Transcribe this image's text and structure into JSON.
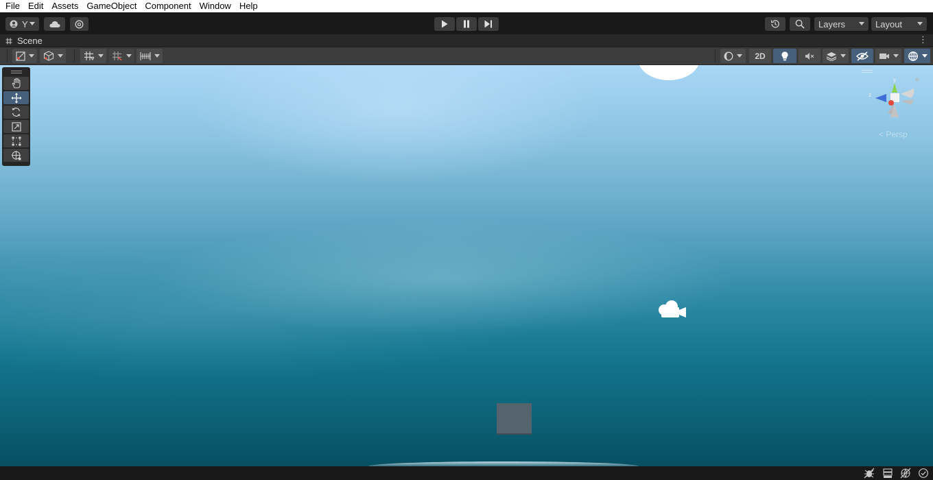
{
  "menu": [
    "File",
    "Edit",
    "Assets",
    "GameObject",
    "Component",
    "Window",
    "Help"
  ],
  "toolbar": {
    "account_label": "Y",
    "account_icon": "account-icon",
    "cloud_icon": "cloud-icon",
    "collab_icon": "services-icon",
    "play_icon": "play-icon",
    "pause_icon": "pause-icon",
    "step_icon": "step-icon",
    "history_icon": "history-icon",
    "search_icon": "search-icon",
    "layers_label": "Layers",
    "layout_label": "Layout"
  },
  "scene_tab": {
    "title": "Scene",
    "menu_icon": "kebab-menu-icon"
  },
  "scene_toolbar": {
    "two_d_label": "2D"
  },
  "tools": [
    "hand-tool",
    "move-tool",
    "rotate-tool",
    "scale-tool",
    "rect-tool",
    "transform-tool"
  ],
  "active_tool": "move-tool",
  "gizmo": {
    "persp_label": "< Persp",
    "y_axis": "y",
    "z_axis": "z"
  },
  "colors": {
    "active_blue": "#46607c",
    "menubar_bg": "#ffffff",
    "toolbar_bg": "#191919",
    "sky_top": "#a9d6f5",
    "ground": "#084f62"
  }
}
